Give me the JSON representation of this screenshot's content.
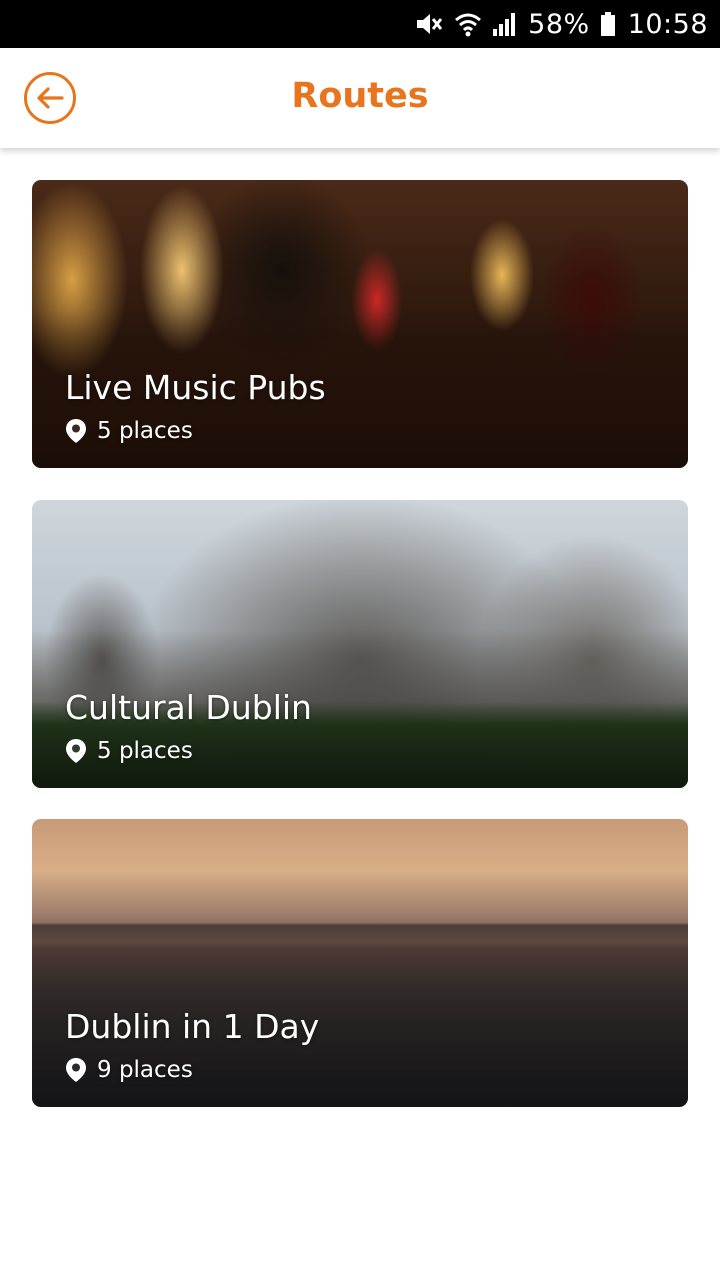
{
  "status_bar": {
    "battery_percent": "58%",
    "time": "10:58",
    "icons": [
      "mute-icon",
      "wifi-icon",
      "signal-icon",
      "battery-icon"
    ]
  },
  "header": {
    "title": "Routes",
    "back_icon": "back-arrow-icon"
  },
  "colors": {
    "accent": "#e8741e",
    "status_bar_bg": "#000000",
    "background": "#ffffff"
  },
  "routes": [
    {
      "title": "Live Music Pubs",
      "places": "5 places",
      "icon": "location-pin-icon"
    },
    {
      "title": "Cultural Dublin",
      "places": "5 places",
      "icon": "location-pin-icon"
    },
    {
      "title": "Dublin in 1 Day",
      "places": "9 places",
      "icon": "location-pin-icon"
    }
  ]
}
